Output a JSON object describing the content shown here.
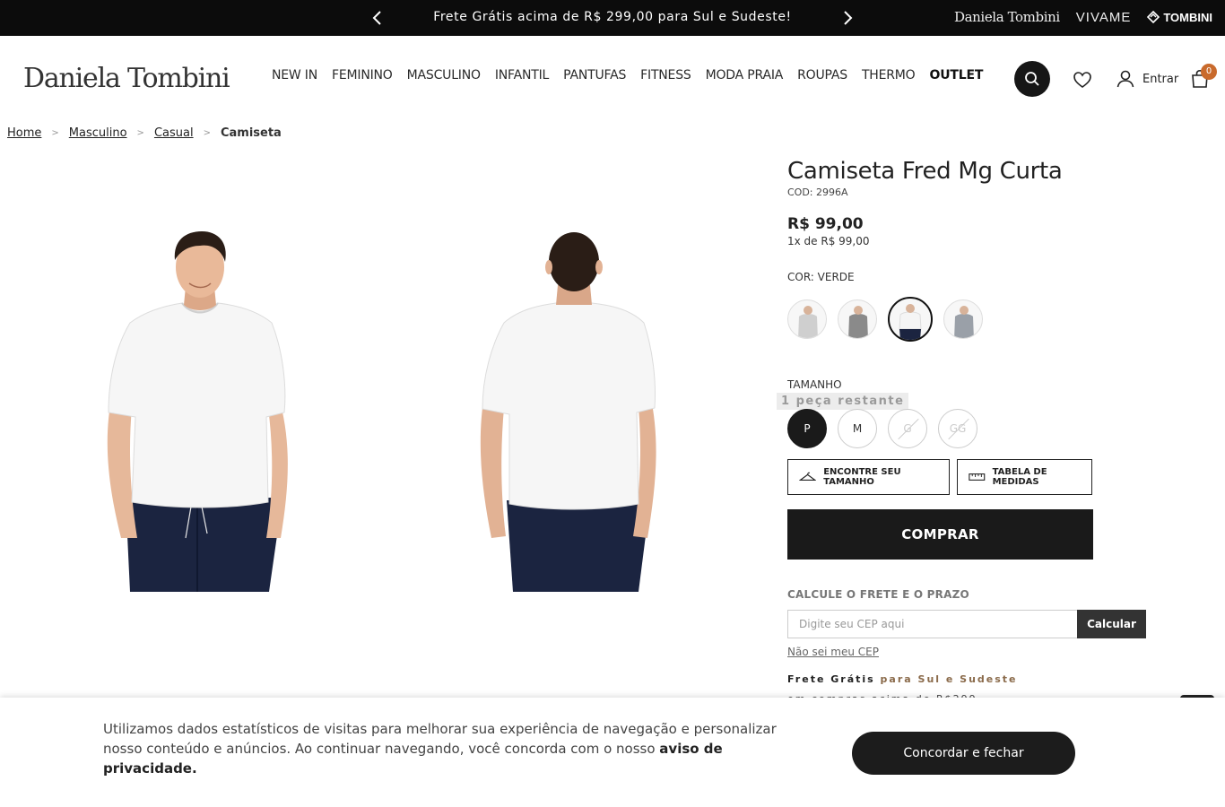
{
  "topbar": {
    "message": "Frete Grátis acima de R$ 299,00 para Sul e Sudeste!",
    "brands": [
      "Daniela Tombini",
      "VIVAME",
      "TOMBINI"
    ]
  },
  "header": {
    "logo": "Daniela Tombini",
    "nav": [
      "NEW IN",
      "FEMININO",
      "MASCULINO",
      "INFANTIL",
      "PANTUFAS",
      "FITNESS",
      "MODA PRAIA",
      "ROUPAS",
      "THERMO",
      "OUTLET"
    ],
    "login_label": "Entrar",
    "cart_count": "0"
  },
  "breadcrumb": [
    "Home",
    "Masculino",
    "Casual",
    "Camiseta"
  ],
  "product": {
    "title": "Camiseta Fred Mg Curta",
    "code": "COD: 2996A",
    "price": "R$ 99,00",
    "installments": "1x de R$ 99,00",
    "color_label": "COR: VERDE",
    "size_label": "TAMANHO",
    "stock_note": "1 peça restante",
    "sizes": [
      {
        "label": "P",
        "state": "selected"
      },
      {
        "label": "M",
        "state": "available"
      },
      {
        "label": "G",
        "state": "unavailable"
      },
      {
        "label": "GG",
        "state": "unavailable"
      }
    ],
    "find_size_label": "ENCONTRE SEU TAMANHO",
    "size_table_label": "TABELA DE MEDIDAS",
    "buy_label": "COMPRAR"
  },
  "shipping": {
    "label": "CALCULE O FRETE E O PRAZO",
    "placeholder": "Digite seu CEP aqui",
    "button": "Calcular",
    "dont_know": "Não sei meu CEP",
    "free_title": "Frete Grátis",
    "free_region": "para Sul e Sudeste",
    "free_sub": "em compras acima de R$299"
  },
  "cookie": {
    "text": "Utilizamos dados estatísticos de visitas para melhorar sua experiência de navegação e personalizar nosso conteúdo e anúncios. Ao continuar navegando, você concorda com o nosso ",
    "link": "aviso de privacidade.",
    "button": "Concordar e fechar"
  },
  "colors": {
    "accent_badge": "#c96a2c",
    "dark": "#1a1a1a",
    "free_accent": "#8a6a4a"
  }
}
